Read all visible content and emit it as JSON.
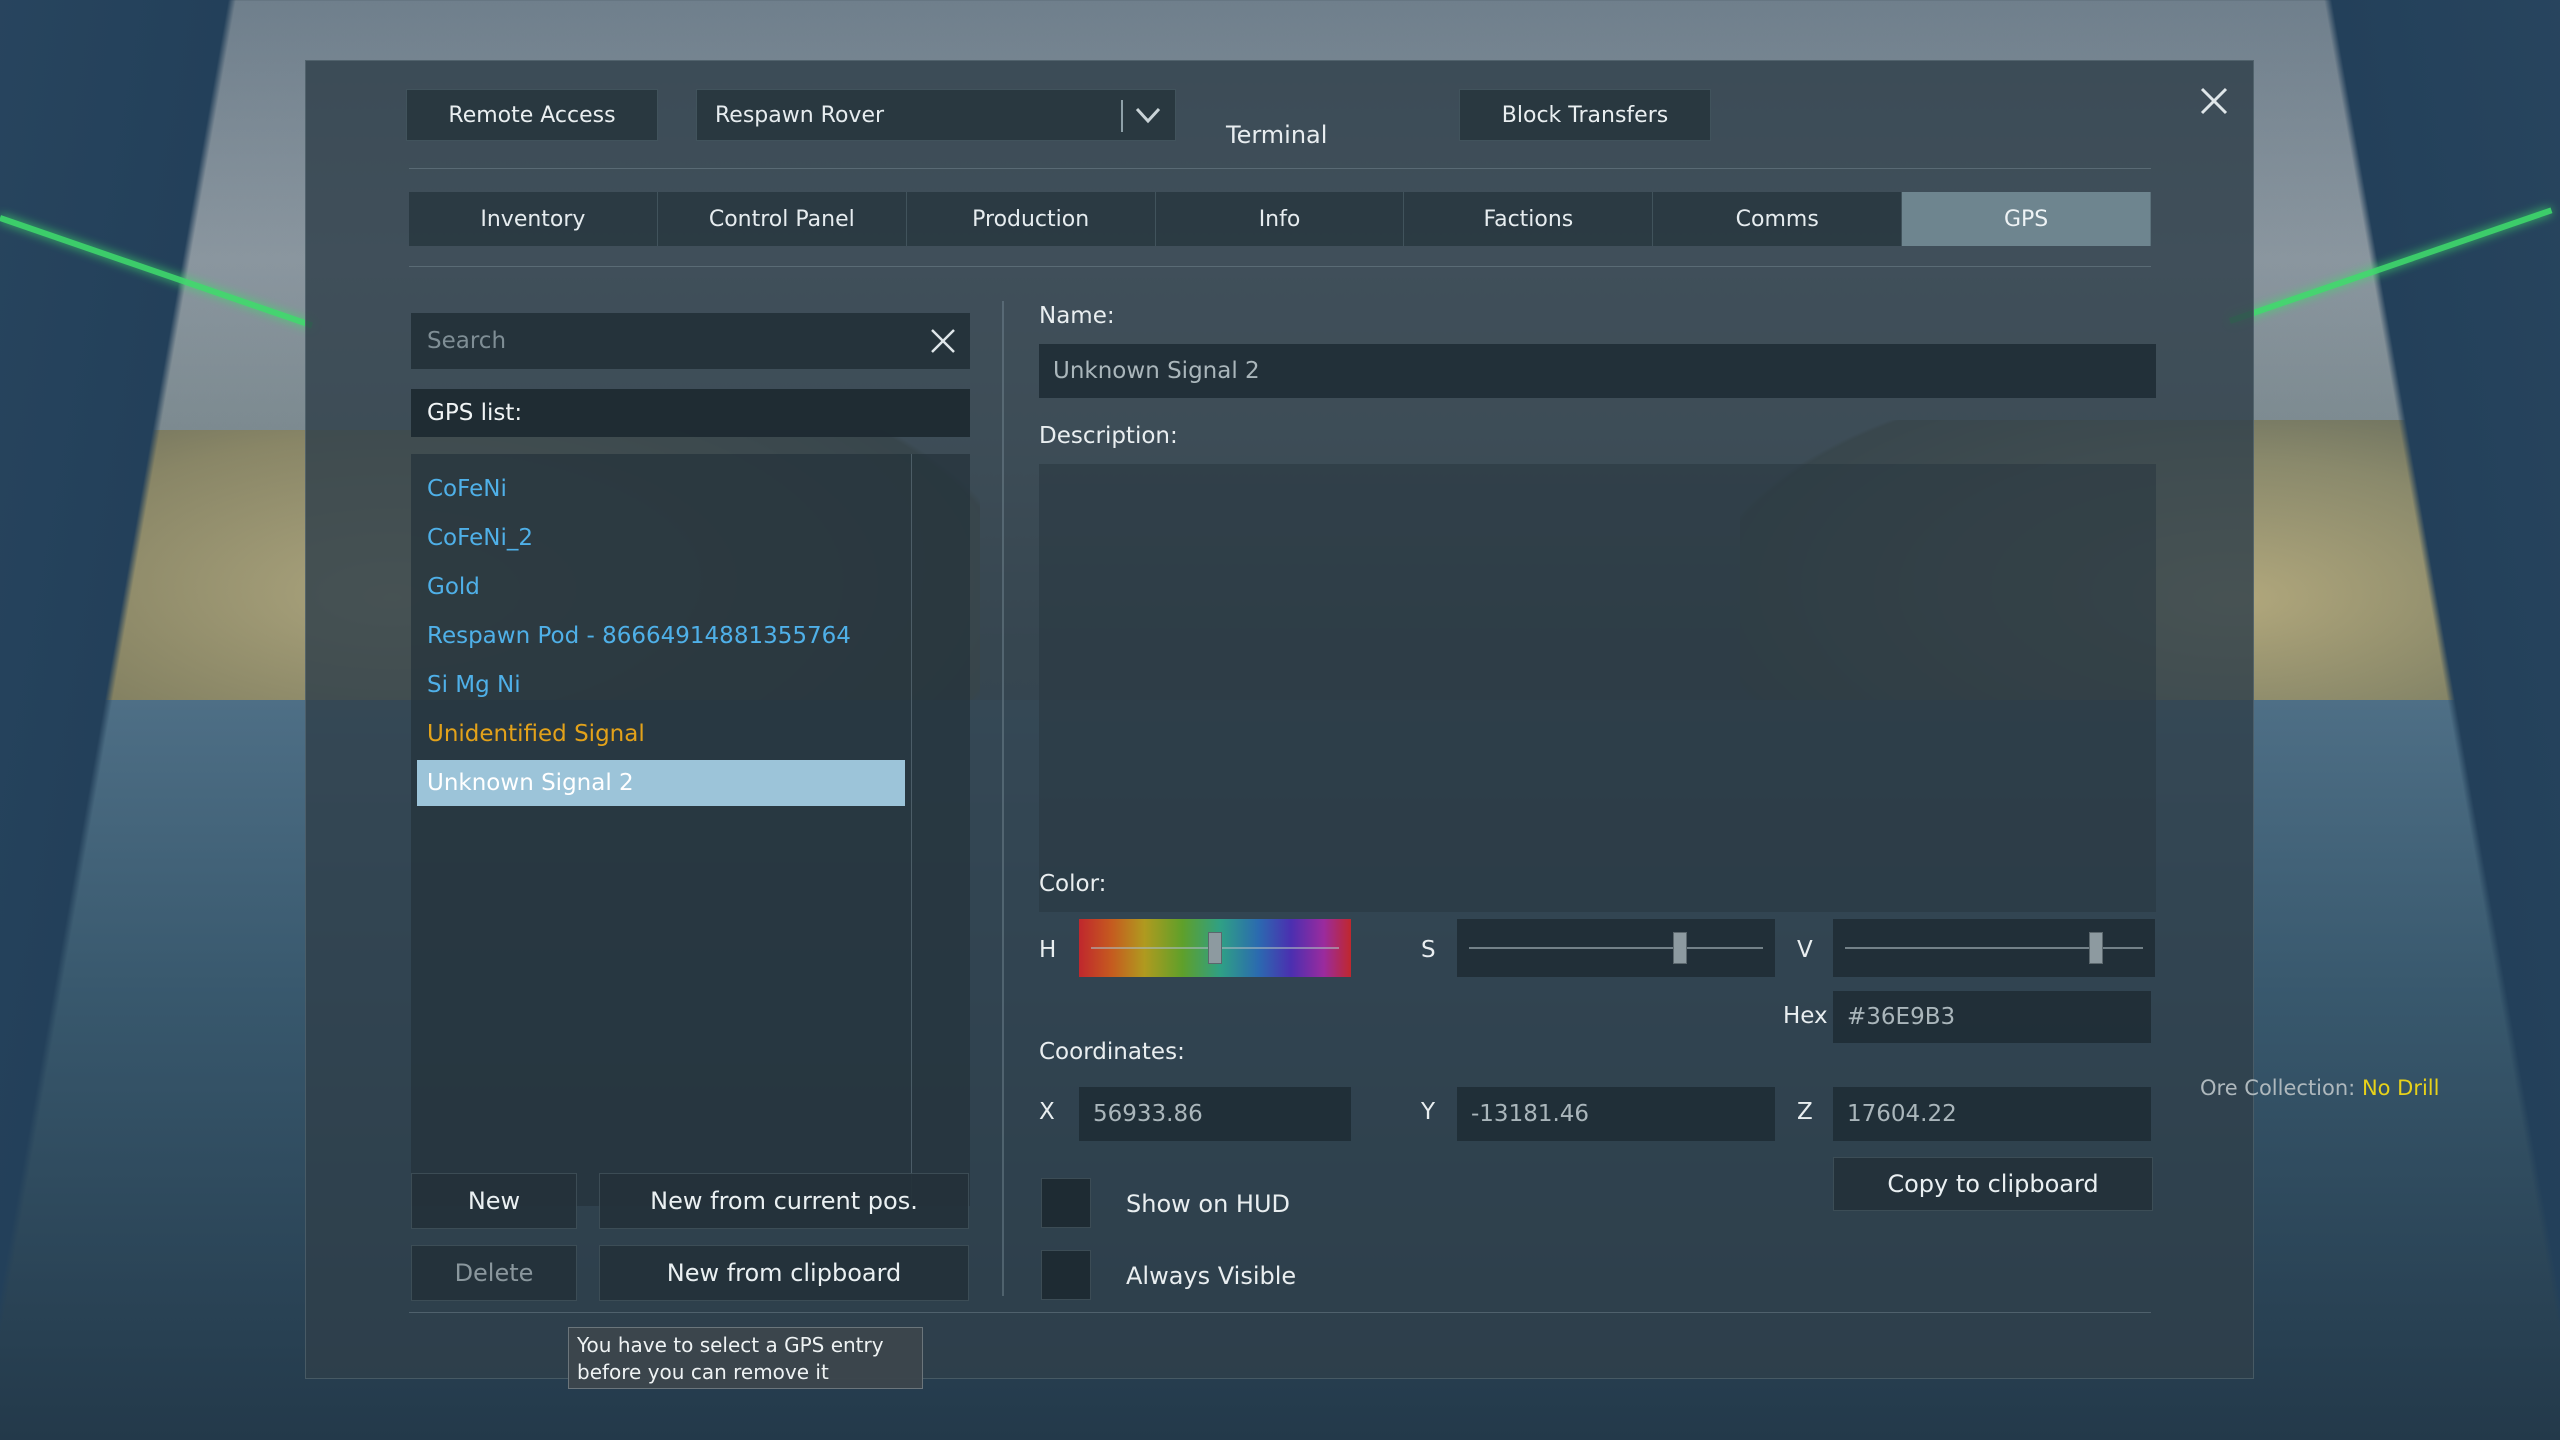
{
  "header": {
    "remote_access": "Remote Access",
    "grid_selector": "Respawn Rover",
    "title": "Terminal",
    "block_transfers": "Block Transfers"
  },
  "tabs": [
    {
      "label": "Inventory"
    },
    {
      "label": "Control Panel"
    },
    {
      "label": "Production"
    },
    {
      "label": "Info"
    },
    {
      "label": "Factions"
    },
    {
      "label": "Comms"
    },
    {
      "label": "GPS",
      "active": true
    }
  ],
  "left": {
    "search_placeholder": "Search",
    "gps_list_title": "GPS list:",
    "items": [
      {
        "label": "CoFeNi",
        "color": "#4fb0e8"
      },
      {
        "label": "CoFeNi_2",
        "color": "#4fb0e8"
      },
      {
        "label": "Gold",
        "color": "#4fb0e8"
      },
      {
        "label": "Respawn Pod - 86664914881355764",
        "color": "#4fb0e8"
      },
      {
        "label": "Si Mg Ni",
        "color": "#4fb0e8"
      },
      {
        "label": "Unidentified Signal",
        "color": "#e3a21a"
      },
      {
        "label": "Unknown Signal 2",
        "color": "#ffffff",
        "selected": true
      }
    ],
    "buttons": {
      "new": "New",
      "new_from_pos": "New from current pos.",
      "delete": "Delete",
      "new_from_clipboard": "New from clipboard"
    },
    "tooltip": {
      "line1": "You have to select a GPS entry",
      "line2": "before you can remove it"
    }
  },
  "right": {
    "name_label": "Name:",
    "name_value": "Unknown Signal 2",
    "description_label": "Description:",
    "description_value": "",
    "color_label": "Color:",
    "h_label": "H",
    "s_label": "S",
    "v_label": "V",
    "hue_level": 0.5,
    "saturation_level": 0.73,
    "value_level": 0.86,
    "hex_label": "Hex",
    "hex_value": "#36E9B3",
    "coordinates_label": "Coordinates:",
    "x_label": "X",
    "x_value": "56933.86",
    "y_label": "Y",
    "y_value": "-13181.46",
    "z_label": "Z",
    "z_value": "17604.22",
    "copy_button": "Copy to clipboard",
    "show_on_hud": "Show on  HUD",
    "always_visible": "Always Visible"
  },
  "hud": {
    "ore_label": "Ore Collection:",
    "ore_value": "No Drill"
  },
  "colors": {
    "accent_tab": "#6e858f",
    "selected_item": "#9cc4d9",
    "laser": "#3fdc6c"
  }
}
